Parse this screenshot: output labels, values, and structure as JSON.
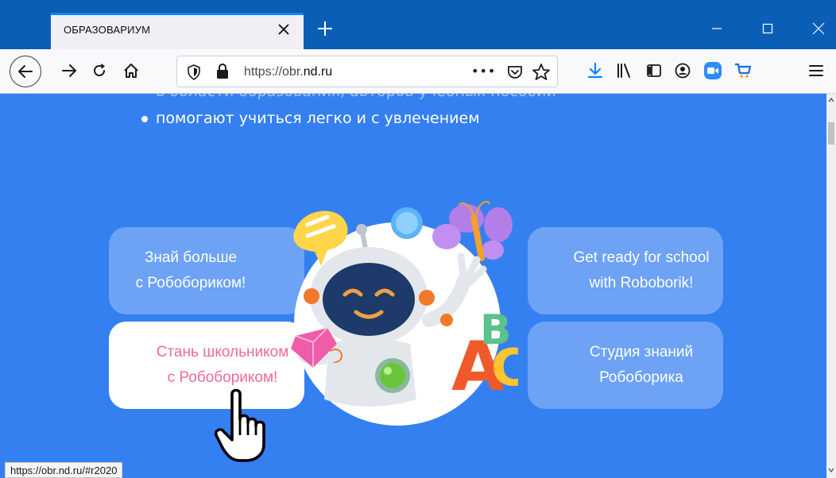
{
  "browser": {
    "tab_title": "ОБРАЗОВАРИУМ",
    "url_prefix": "https://obr.",
    "url_domain": "nd.ru",
    "page_actions_label": "•••",
    "status_url": "https://obr.nd.ru/#r2020"
  },
  "content": {
    "bullet_partial": "в области образования, авторов учебных пособий",
    "bullet_2": "помогают учиться легко и с увлечением",
    "cards": {
      "top_left": {
        "line1": "Знай больше",
        "line2": "с Робобориком!"
      },
      "top_right": {
        "line1": "Get ready for school",
        "line2": "with Roboborik!"
      },
      "bottom_left": {
        "line1": "Стань школьником",
        "line2": "с Робобориком!"
      },
      "bottom_right": {
        "line1": "Студия знаний",
        "line2": "Робоборика"
      }
    },
    "letters": [
      "A",
      "B",
      "C"
    ]
  },
  "colors": {
    "titlebar": "#0a5eb6",
    "content_bg": "#3580f0",
    "card_blue": "#6da2f5",
    "card_pink_text": "#ee6a9a"
  }
}
